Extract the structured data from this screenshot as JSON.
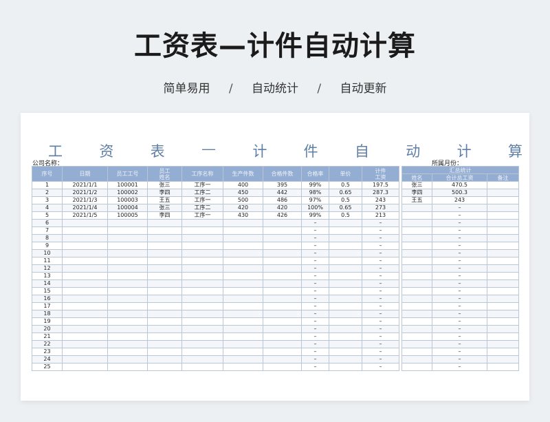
{
  "hero": {
    "title": "工资表—计件自动计算",
    "tags": [
      "简单易用",
      "自动统计",
      "自动更新"
    ],
    "separator": "/"
  },
  "sheet": {
    "title_chars": [
      "工",
      "资",
      "表",
      "—",
      "计",
      "件",
      "自",
      "动",
      "计",
      "算"
    ],
    "company_label": "公司名称：",
    "month_label": "所属月份："
  },
  "main_table": {
    "headers": [
      "序号",
      "日期",
      "员工工号",
      "员工\n姓名",
      "工序名称",
      "生产件数",
      "合格件数",
      "合格率",
      "单价",
      "计件\n工资"
    ],
    "rows": [
      [
        "1",
        "2021/1/1",
        "100001",
        "张三",
        "工序一",
        "400",
        "395",
        "99%",
        "0.5",
        "197.5"
      ],
      [
        "2",
        "2021/1/2",
        "100002",
        "李四",
        "工序二",
        "450",
        "442",
        "98%",
        "0.65",
        "287.3"
      ],
      [
        "3",
        "2021/1/3",
        "100003",
        "王五",
        "工序一",
        "500",
        "486",
        "97%",
        "0.5",
        "243"
      ],
      [
        "4",
        "2021/1/4",
        "100004",
        "张三",
        "工序二",
        "420",
        "420",
        "100%",
        "0.65",
        "273"
      ],
      [
        "5",
        "2021/1/5",
        "100005",
        "李四",
        "工序一",
        "430",
        "426",
        "99%",
        "0.5",
        "213"
      ]
    ],
    "total_rows": 25,
    "empty_placeholder": "–"
  },
  "summary_table": {
    "title": "汇总统计",
    "headers": [
      "姓名",
      "合计总工资",
      "备注"
    ],
    "rows": [
      [
        "张三",
        "470.5",
        ""
      ],
      [
        "李四",
        "500.3",
        ""
      ],
      [
        "王五",
        "243",
        ""
      ]
    ],
    "empty_placeholder": "–"
  },
  "colors": {
    "header_bg": "#94add2",
    "title_blue": "#5e7fa6",
    "page_bg": "#edf0f3"
  }
}
